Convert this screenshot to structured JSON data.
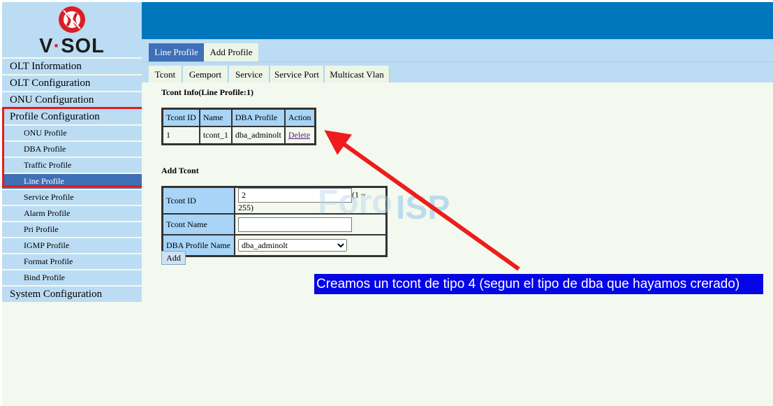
{
  "brand": {
    "name_left": "V",
    "name_dot": "·",
    "name_right": "SOL"
  },
  "sidebar": {
    "menus": [
      "OLT Information",
      "OLT Configuration",
      "ONU Configuration",
      "Profile Configuration"
    ],
    "profile_items": [
      "ONU Profile",
      "DBA Profile",
      "Traffic Profile",
      "Line Profile",
      "Service Profile",
      "Alarm Profile",
      "Pri Profile",
      "IGMP Profile",
      "Format Profile",
      "Bind Profile"
    ],
    "active_item": "Line Profile",
    "last_menu": "System Configuration"
  },
  "tabs_top": [
    "Line Profile",
    "Add Profile"
  ],
  "tabs_sub": [
    "Tcont",
    "Gemport",
    "Service",
    "Service Port",
    "Multicast Vlan"
  ],
  "tcont_info": {
    "title": "Tcont Info(Line Profile:1)",
    "headers": [
      "Tcont ID",
      "Name",
      "DBA Profile",
      "Action"
    ],
    "rows": [
      {
        "id": "1",
        "name": "tcont_1",
        "dba": "dba_adminolt",
        "action": "Delete"
      }
    ]
  },
  "add_tcont": {
    "title": "Add Tcont",
    "id_label": "Tcont ID",
    "id_value": "2",
    "id_range": "(1 ~ 255)",
    "name_label": "Tcont Name",
    "name_value": "",
    "dba_label": "DBA Profile Name",
    "dba_selected": "dba_adminolt",
    "button": "Add"
  },
  "watermark": {
    "left": "Foro",
    "right": "ISP"
  },
  "annotation": "Creamos un tcont de tipo 4 (segun el tipo de dba que hayamos crerado)",
  "colors": {
    "header_blue": "#0077bc",
    "menu_bg": "#bcdcf3",
    "active_bg": "#3f6fb7",
    "highlight_red": "#e61b1b",
    "annotation_bg": "#0505e6"
  }
}
